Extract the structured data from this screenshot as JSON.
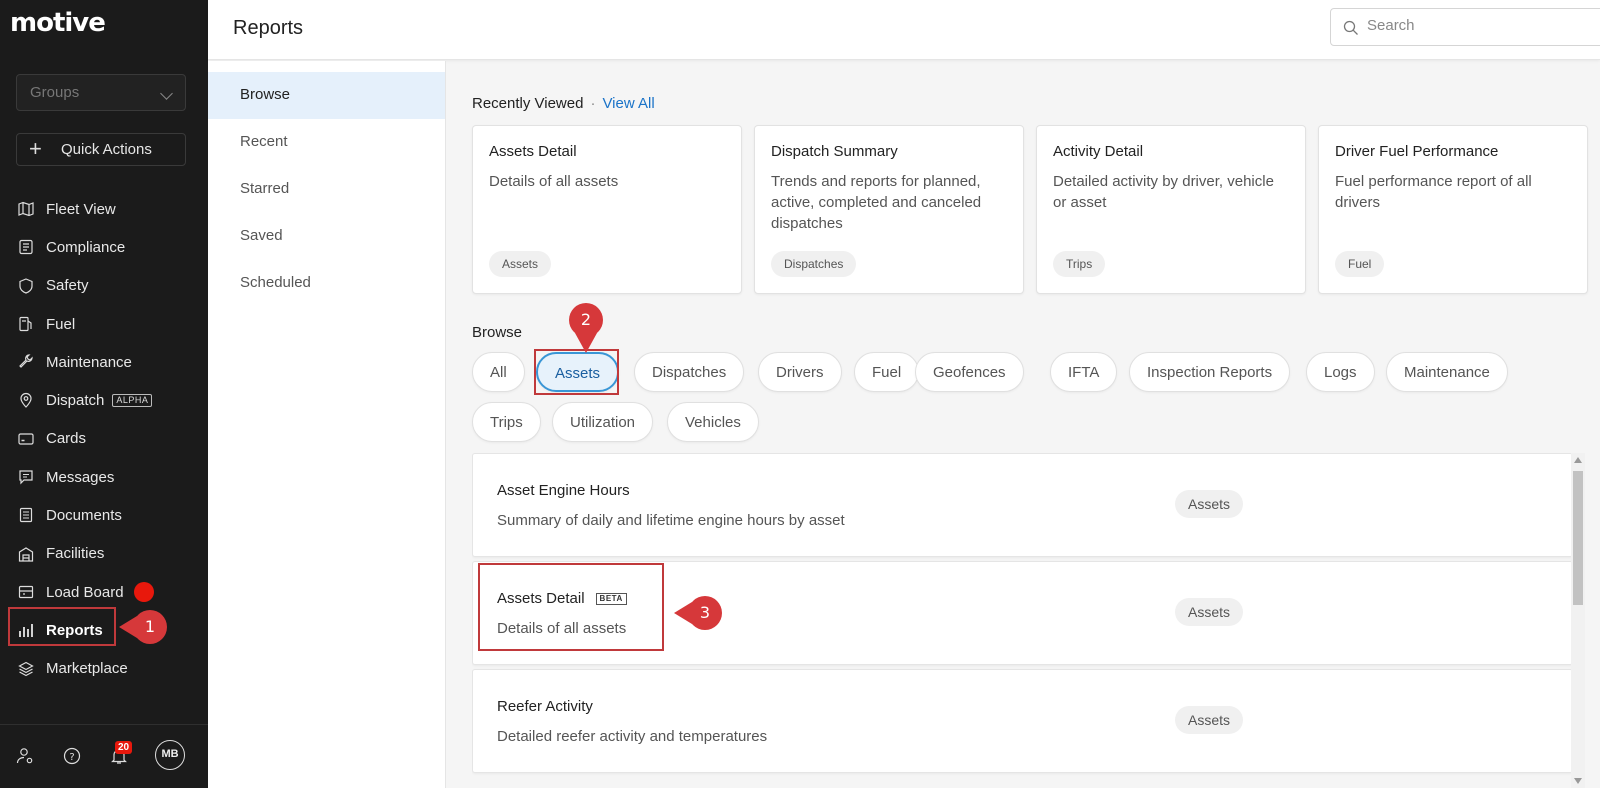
{
  "app": {
    "logo": "motive"
  },
  "sidebar": {
    "groups_placeholder": "Groups",
    "quick_actions": "Quick Actions",
    "items": [
      {
        "label": "Fleet View",
        "icon": "map-icon"
      },
      {
        "label": "Compliance",
        "icon": "clipboard-icon"
      },
      {
        "label": "Safety",
        "icon": "shield-icon"
      },
      {
        "label": "Fuel",
        "icon": "fuel-pump-icon"
      },
      {
        "label": "Maintenance",
        "icon": "wrench-icon"
      },
      {
        "label": "Dispatch",
        "icon": "location-pin-icon",
        "badge": "ALPHA"
      },
      {
        "label": "Cards",
        "icon": "card-icon"
      },
      {
        "label": "Messages",
        "icon": "chat-icon"
      },
      {
        "label": "Documents",
        "icon": "document-icon"
      },
      {
        "label": "Facilities",
        "icon": "building-icon"
      },
      {
        "label": "Load Board",
        "icon": "truck-icon"
      },
      {
        "label": "Reports",
        "icon": "bar-chart-icon",
        "active": true
      },
      {
        "label": "Marketplace",
        "icon": "layers-icon"
      }
    ],
    "notifications_count": "20",
    "avatar_initials": "MB"
  },
  "header": {
    "title": "Reports",
    "search_placeholder": "Search"
  },
  "subnav": {
    "items": [
      "Browse",
      "Recent",
      "Starred",
      "Saved",
      "Scheduled"
    ],
    "active": "Browse"
  },
  "recently_viewed": {
    "title": "Recently Viewed",
    "separator": "·",
    "view_all": "View All",
    "cards": [
      {
        "title": "Assets Detail",
        "desc": "Details of all assets",
        "tag": "Assets"
      },
      {
        "title": "Dispatch Summary",
        "desc": "Trends and reports for planned, active, completed and canceled dispatches",
        "tag": "Dispatches"
      },
      {
        "title": "Activity Detail",
        "desc": "Detailed activity by driver, vehicle or asset",
        "tag": "Trips"
      },
      {
        "title": "Driver Fuel Performance",
        "desc": "Fuel performance report of all drivers",
        "tag": "Fuel"
      }
    ]
  },
  "browse": {
    "title": "Browse",
    "chips": [
      "All",
      "Assets",
      "Dispatches",
      "Drivers",
      "Fuel",
      "Geofences",
      "IFTA",
      "Inspection Reports",
      "Logs",
      "Maintenance",
      "Trips",
      "Utilization",
      "Vehicles"
    ],
    "active_chip": "Assets",
    "reports": [
      {
        "title": "Asset Engine Hours",
        "desc": "Summary of daily and lifetime engine hours by asset",
        "tag": "Assets"
      },
      {
        "title": "Assets Detail",
        "badge": "BETA",
        "desc": "Details of all assets",
        "tag": "Assets"
      },
      {
        "title": "Reefer Activity",
        "desc": "Detailed reefer activity and temperatures",
        "tag": "Assets"
      }
    ]
  },
  "callouts": {
    "one": "1",
    "two": "2",
    "three": "3"
  },
  "colors": {
    "accent": "#1a73c8",
    "callout": "#d6383a",
    "sidebar_bg": "#1b1b1b",
    "active_chip_border": "#3996d6"
  }
}
